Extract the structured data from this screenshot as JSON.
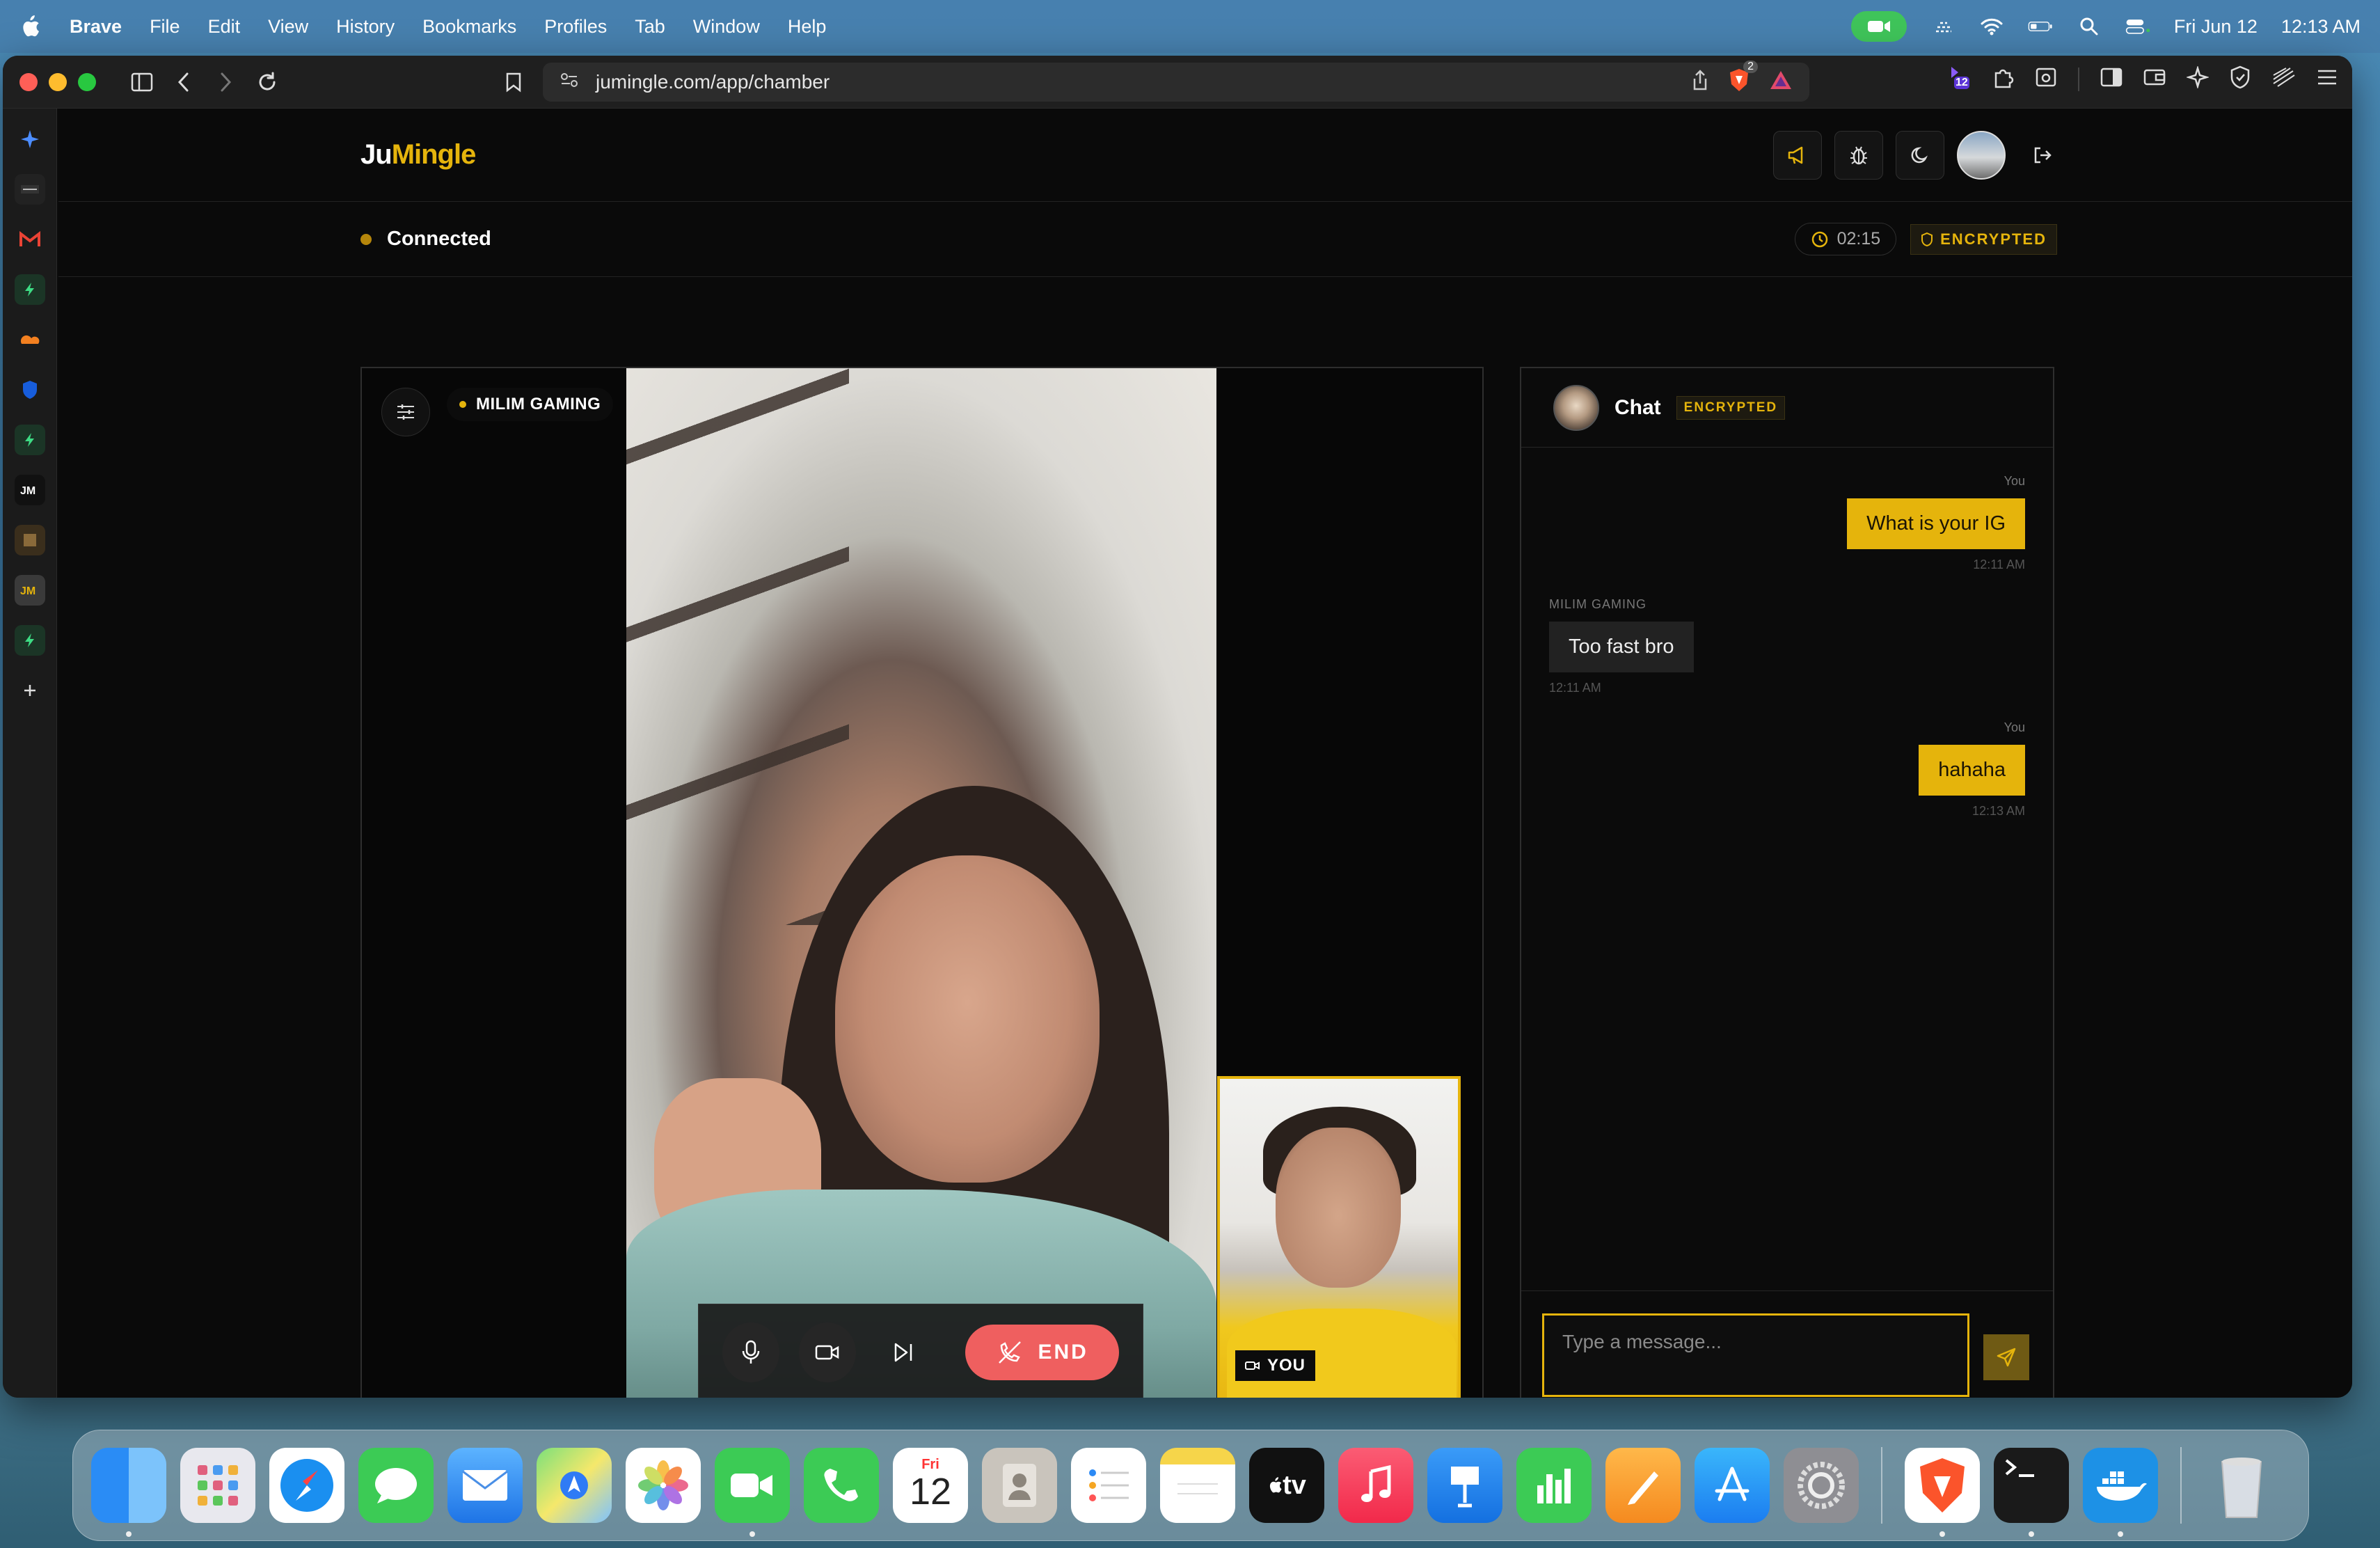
{
  "menubar": {
    "app_name": "Brave",
    "items": [
      "File",
      "Edit",
      "View",
      "History",
      "Bookmarks",
      "Profiles",
      "Tab",
      "Window",
      "Help"
    ],
    "date": "Fri Jun 12",
    "time": "12:13 AM"
  },
  "browser": {
    "url": "jumingle.com/app/chamber",
    "brave_badge_count": "2",
    "extension_badge": "12"
  },
  "app": {
    "logo_part1": "Ju",
    "logo_part2": "Mingle",
    "accent_color": "#e5b40c",
    "status": "Connected",
    "timer": "02:15",
    "encrypted_label": "ENCRYPTED"
  },
  "video": {
    "peer_name": "MILIM GAMING",
    "self_label": "YOU",
    "end_label": "END"
  },
  "chat": {
    "title": "Chat",
    "encrypted_label": "ENCRYPTED",
    "messages": [
      {
        "sender": "You",
        "text": "What is your IG",
        "time": "12:11 AM",
        "mine": true
      },
      {
        "sender": "MILIM GAMING",
        "text": "Too fast bro",
        "time": "12:11 AM",
        "mine": false
      },
      {
        "sender": "You",
        "text": "hahaha",
        "time": "12:13 AM",
        "mine": true
      }
    ],
    "input_placeholder": "Type a message..."
  },
  "dock": {
    "calendar_day": "Fri",
    "calendar_date": "12",
    "tv_label": "tv"
  }
}
